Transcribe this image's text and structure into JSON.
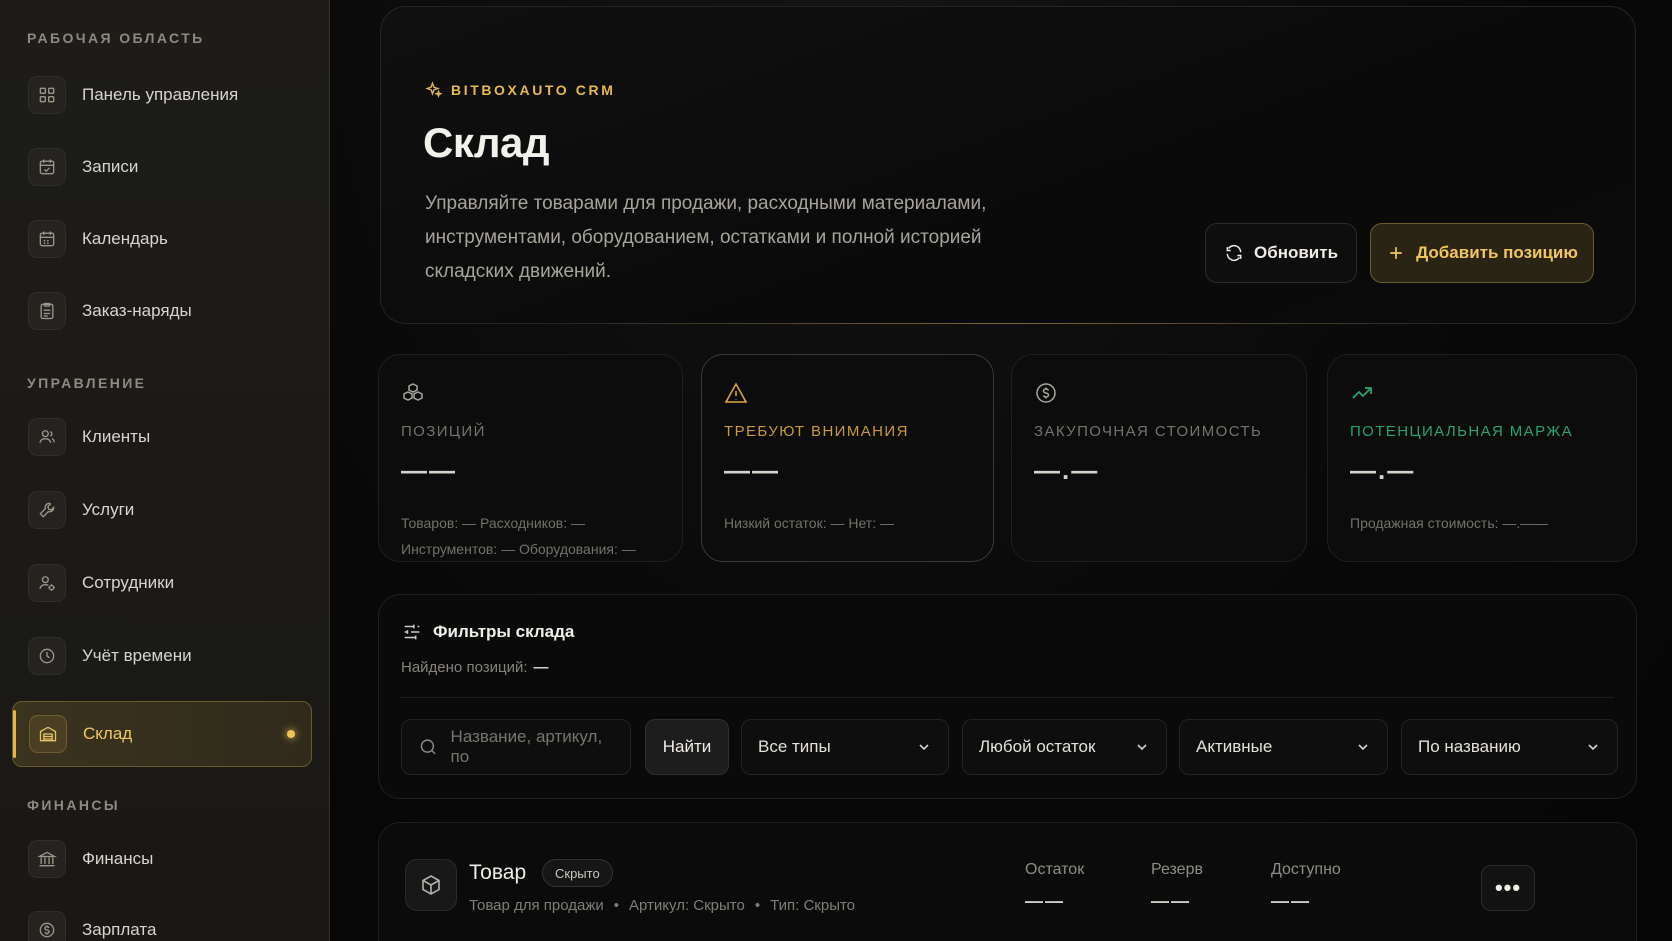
{
  "sidebar": {
    "sections": [
      {
        "title": "РАБОЧАЯ ОБЛАСТЬ"
      },
      {
        "title": "УПРАВЛЕНИЕ"
      },
      {
        "title": "ФИНАНСЫ"
      }
    ],
    "items": [
      {
        "label": "Панель управления",
        "icon": "grid-icon"
      },
      {
        "label": "Записи",
        "icon": "calendar-check-icon"
      },
      {
        "label": "Календарь",
        "icon": "calendar-icon"
      },
      {
        "label": "Заказ-наряды",
        "icon": "clipboard-icon"
      },
      {
        "label": "Клиенты",
        "icon": "users-icon"
      },
      {
        "label": "Услуги",
        "icon": "wrench-icon"
      },
      {
        "label": "Сотрудники",
        "icon": "user-gear-icon"
      },
      {
        "label": "Учёт времени",
        "icon": "clock-icon"
      },
      {
        "label": "Склад",
        "icon": "warehouse-icon",
        "active": true
      },
      {
        "label": "Финансы",
        "icon": "bank-icon"
      },
      {
        "label": "Зарплата",
        "icon": "money-icon"
      }
    ]
  },
  "hero": {
    "brand": "BITBOXAUTO CRM",
    "title": "Склад",
    "description": "Управляйте товарами для продажи, расходными материалами, инструментами, оборудованием, остатками и полной историей складских движений.",
    "refresh_label": "Обновить",
    "add_label": "Добавить позицию"
  },
  "stats": {
    "positions": {
      "label": "ПОЗИЦИЙ",
      "value": "——",
      "sub1": "Товаров: —   Расходников: —",
      "sub2": "Инструментов: —   Оборудования: —"
    },
    "attention": {
      "label": "ТРЕБУЮТ ВНИМАНИЯ",
      "value": "——",
      "sub1": "Низкий остаток: —   Нет: —"
    },
    "purchase": {
      "label": "ЗАКУПОЧНАЯ СТОИМОСТЬ",
      "value": "—.—"
    },
    "margin": {
      "label": "ПОТЕНЦИАЛЬНАЯ МАРЖА",
      "value": "—.—",
      "sub1": "Продажная стоимость: —.——"
    }
  },
  "filters": {
    "title": "Фильтры склада",
    "found_label": "Найдено позиций:",
    "found_value": "—",
    "search_placeholder": "Название, артикул, по",
    "find_label": "Найти",
    "type_select": "Все типы",
    "stock_select": "Любой остаток",
    "status_select": "Активные",
    "sort_select": "По названию"
  },
  "product": {
    "name": "Товар",
    "badge": "Скрыто",
    "type_text": "Товар для продажи",
    "sku_text": "Артикул: Скрыто",
    "kind_text": "Тип: Скрыто",
    "stock_label": "Остаток",
    "stock_value": "——",
    "reserve_label": "Резерв",
    "reserve_value": "——",
    "available_label": "Доступно",
    "available_value": "——",
    "more_label": "•••"
  },
  "colors": {
    "accent": "#e5b94f",
    "margin_green": "#2aa36d",
    "warning": "#c79a3c"
  }
}
